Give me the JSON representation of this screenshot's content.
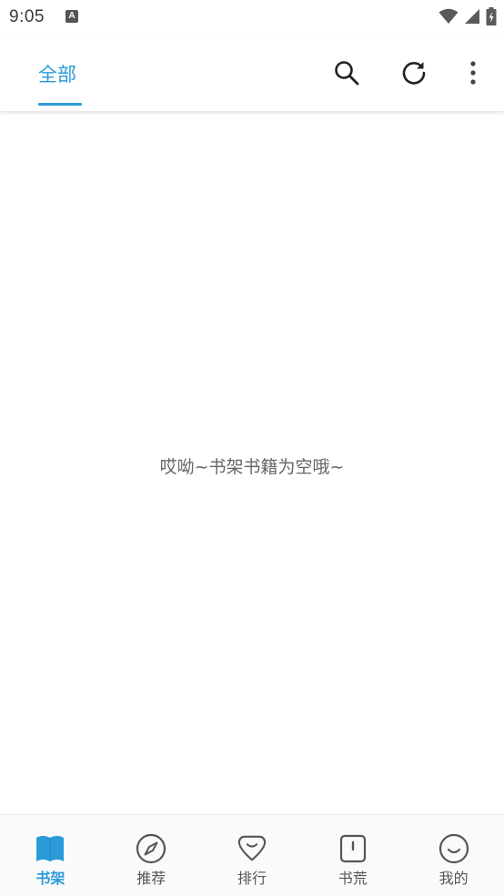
{
  "status_bar": {
    "time": "9:05",
    "notification_icon": "A"
  },
  "top_bar": {
    "tab_label": "全部",
    "icons": [
      "search-icon",
      "refresh-icon",
      "more-vert-icon"
    ]
  },
  "main": {
    "empty_message": "哎呦~书架书籍为空哦~"
  },
  "bottom_nav": {
    "items": [
      {
        "label": "书架",
        "icon": "book-icon",
        "active": true
      },
      {
        "label": "推荐",
        "icon": "compass-icon",
        "active": false
      },
      {
        "label": "排行",
        "icon": "heart-shield-icon",
        "active": false
      },
      {
        "label": "书荒",
        "icon": "notebook-icon",
        "active": false
      },
      {
        "label": "我的",
        "icon": "smile-icon",
        "active": false
      }
    ]
  },
  "colors": {
    "accent": "#2b9ad8",
    "text_gray": "#666666",
    "icon_gray": "#555555"
  }
}
